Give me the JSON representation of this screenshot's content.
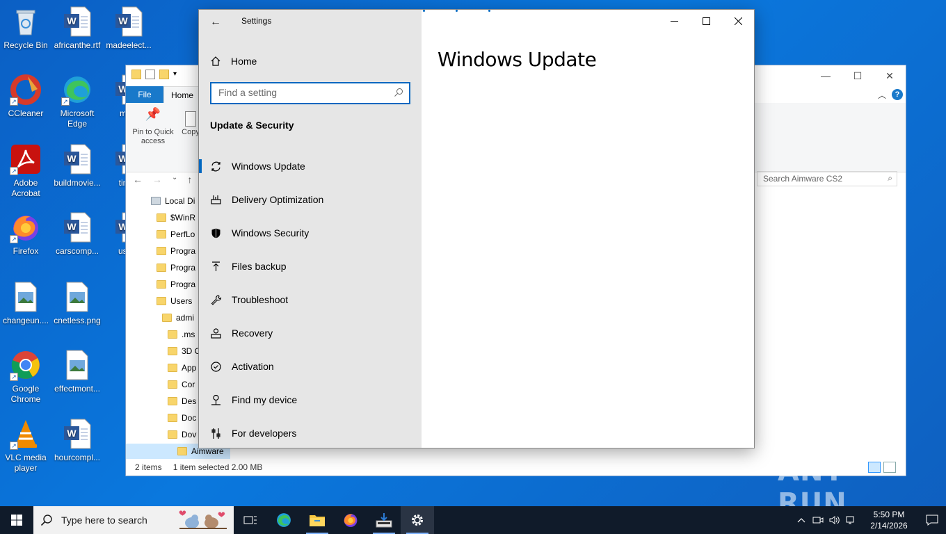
{
  "desktop": {
    "icons": [
      {
        "label": "Recycle Bin"
      },
      {
        "label": "africanthe.rtf"
      },
      {
        "label": "madeelect..."
      },
      {
        "label": "CCleaner"
      },
      {
        "label": "Microsoft Edge"
      },
      {
        "label": "must"
      },
      {
        "label": "Adobe Acrobat"
      },
      {
        "label": "buildmovie..."
      },
      {
        "label": "times"
      },
      {
        "label": "Firefox"
      },
      {
        "label": "carscomp..."
      },
      {
        "label": "userp"
      },
      {
        "label": "changeun...."
      },
      {
        "label": "cnetless.png"
      },
      {
        "label": "Google Chrome"
      },
      {
        "label": "effectmont..."
      },
      {
        "label": "VLC media player"
      },
      {
        "label": "hourcompl..."
      }
    ],
    "watermark": "ANY RUN"
  },
  "explorer": {
    "tab_file": "File",
    "tab_home": "Home",
    "ribbon": {
      "pin_label": "Pin to Quick access",
      "copy_label": "Copy"
    },
    "search_placeholder": "Search Aimware CS2",
    "tree": [
      {
        "label": "Local Di",
        "indent": 0
      },
      {
        "label": "$WinR",
        "indent": 1
      },
      {
        "label": "PerfLo",
        "indent": 1
      },
      {
        "label": "Progra",
        "indent": 1
      },
      {
        "label": "Progra",
        "indent": 1
      },
      {
        "label": "Progra",
        "indent": 1
      },
      {
        "label": "Users",
        "indent": 1
      },
      {
        "label": "admi",
        "indent": 2
      },
      {
        "label": ".ms",
        "indent": 3
      },
      {
        "label": "3D C",
        "indent": 3
      },
      {
        "label": "App",
        "indent": 3
      },
      {
        "label": "Cor",
        "indent": 3
      },
      {
        "label": "Des",
        "indent": 3
      },
      {
        "label": "Doc",
        "indent": 3
      },
      {
        "label": "Dov",
        "indent": 3
      },
      {
        "label": "Aimware",
        "indent": 3
      }
    ],
    "status": {
      "items": "2 items",
      "selected": "1 item selected  2.00 MB"
    }
  },
  "settings": {
    "app_title": "Settings",
    "home_label": "Home",
    "search_placeholder": "Find a setting",
    "section_title": "Update & Security",
    "page_title": "Windows Update",
    "nav": [
      {
        "label": "Windows Update",
        "icon": "sync-icon",
        "active": true
      },
      {
        "label": "Delivery Optimization",
        "icon": "delivery-icon"
      },
      {
        "label": "Windows Security",
        "icon": "shield-icon"
      },
      {
        "label": "Files backup",
        "icon": "backup-icon"
      },
      {
        "label": "Troubleshoot",
        "icon": "wrench-icon"
      },
      {
        "label": "Recovery",
        "icon": "recovery-icon"
      },
      {
        "label": "Activation",
        "icon": "activation-icon"
      },
      {
        "label": "Find my device",
        "icon": "find-device-icon"
      },
      {
        "label": "For developers",
        "icon": "developer-icon"
      }
    ],
    "accent": "#0067c0"
  },
  "taskbar": {
    "search_placeholder": "Type here to search",
    "time": "5:50 PM",
    "date": "2/14/2026"
  }
}
